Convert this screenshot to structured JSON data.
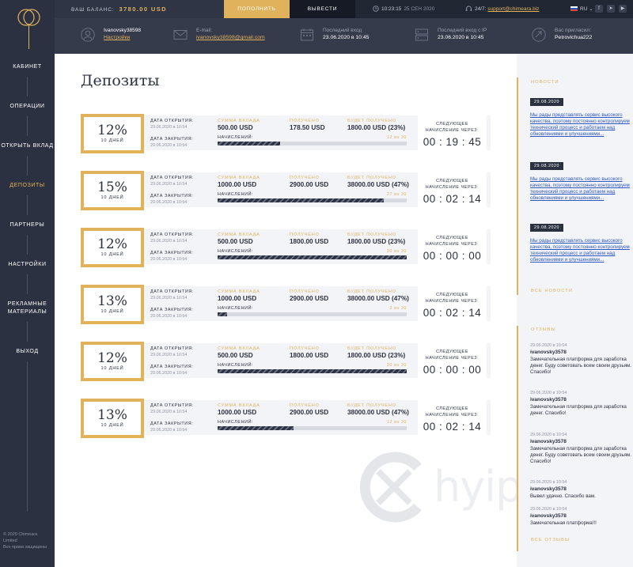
{
  "sidebar": {
    "items": [
      {
        "label": "КАБИНЕТ"
      },
      {
        "label": "ОПЕРАЦИИ"
      },
      {
        "label": "ОТКРЫТЬ ВКЛАД"
      },
      {
        "label": "ДЕПОЗИТЫ"
      },
      {
        "label": "ПАРТНЕРЫ"
      },
      {
        "label": "НАСТРОЙКИ"
      },
      {
        "label_line1": "РЕКЛАМНЫЕ",
        "label_line2": "МАТЕРИАЛЫ"
      },
      {
        "label": "ВЫХОД"
      }
    ],
    "active_index": 3,
    "copyright_line1": "© 2020 Chimeara Limited",
    "copyright_line2": "Все права защищены"
  },
  "topbar": {
    "balance_label": "ВАШ БАЛАНС:",
    "balance_value": "3780.00 USD",
    "deposit_button": "ПОПОЛНИТЬ",
    "withdraw_button": "ВЫВЕСТИ",
    "time": "10:23:15",
    "date": "25 СЕН 2020",
    "support_label": "24/7:",
    "support_email": "support@chimeara.biz",
    "language": "RU",
    "social_icons": [
      "facebook-icon",
      "telegram-icon",
      "youtube-icon"
    ]
  },
  "infobar": {
    "user_name": "Ivanovsky38598",
    "settings_link": "Настройки",
    "email_label": "E-mail:",
    "email_value": "ivanovsky38598@gmail.com",
    "last_login_label": "Последний вход",
    "last_login_value": "23.06.2020 в 10:45",
    "last_ip_label": "Последний вход с IP",
    "last_ip_value": "23.06.2020 в 10:45",
    "referrer_label": "Вас пригласил:",
    "referrer_value": "Petrovichua222"
  },
  "main": {
    "title": "Депозиты",
    "labels": {
      "opened": "ДАТА ОТКРЫТИЯ:",
      "closed": "ДАТА ЗАКРЫТИЯ:",
      "accruals": "НАЧИСЛЕНИЙ:",
      "amount": "СУММА ВКЛАДА",
      "received": "ПОЛУЧЕНО",
      "will_receive": "БУДЕТ ПОЛУЧЕНО",
      "next_accrual": "СЛЕДУЮЩЕЕ",
      "next_accrual_2": "НАЧИСЛЕНИЕ ЧЕРЕЗ:"
    },
    "deposits": [
      {
        "percent": "12%",
        "days": "10 ДНЕЙ",
        "opened": "29.06.2020 в 10:54",
        "closed": "29.06.2020 в 10:54",
        "amount": "500.00 USD",
        "received": "178.50 USD",
        "will_receive": "1800.00 USD (23%)",
        "accruals": "12 из 30",
        "progress": 0.33,
        "timer": "00 : 19 : 45"
      },
      {
        "percent": "15%",
        "days": "10 ДНЕЙ",
        "opened": "29.06.2020 в 10:54",
        "closed": "29.06.2020 в 10:54",
        "amount": "1000.00 USD",
        "received": "2900.00 USD",
        "will_receive": "38000.00 USD (47%)",
        "accruals": "27 из 30",
        "progress": 0.88,
        "timer": "00 : 02 : 14"
      },
      {
        "percent": "12%",
        "days": "10 ДНЕЙ",
        "opened": "29.06.2020 в 10:54",
        "closed": "29.06.2020 в 10:54",
        "amount": "500.00 USD",
        "received": "1800.00 USD",
        "will_receive": "1800.00 USD (23%)",
        "accruals": "30 из 30",
        "progress": 1.0,
        "timer": "00 : 00 : 00"
      },
      {
        "percent": "13%",
        "days": "10 ДНЕЙ",
        "opened": "29.06.2020 в 10:54",
        "closed": "29.06.2020 в 10:54",
        "amount": "1000.00 USD",
        "received": "2900.00 USD",
        "will_receive": "38000.00 USD (47%)",
        "accruals": "2 из 30",
        "progress": 0.05,
        "timer": "00 : 02 : 14"
      },
      {
        "percent": "12%",
        "days": "10 ДНЕЙ",
        "opened": "29.06.2020 в 10:54",
        "closed": "29.06.2020 в 10:54",
        "amount": "500.00 USD",
        "received": "1800.00 USD",
        "will_receive": "1800.00 USD (23%)",
        "accruals": "30 из 30",
        "progress": 1.0,
        "timer": "00 : 00 : 00"
      },
      {
        "percent": "13%",
        "days": "10 ДНЕЙ",
        "opened": "29.06.2020 в 10:54",
        "closed": "29.06.2020 в 10:54",
        "amount": "1000.00 USD",
        "received": "2900.00 USD",
        "will_receive": "38000.00 USD (47%)",
        "accruals": "12 из 30",
        "progress": 0.4,
        "timer": "00 : 02 : 14"
      }
    ]
  },
  "news": {
    "title": "НОВОСТИ",
    "items": [
      {
        "date": "29.08.2020",
        "text": "Мы рады представлять сервис высокого качества, поэтому постоянно контролируем технический процесс и работаем над обновлениями и улучшениями..."
      },
      {
        "date": "29.08.2020",
        "text": "Мы рады представлять сервис высокого качества, поэтому постоянно контролируем технический процесс и работаем над обновлениями и улучшениями..."
      },
      {
        "date": "29.08.2020",
        "text": "Мы рады представлять сервис высокого качества, поэтому постоянно контролируем технический процесс и работаем над обновлениями и улучшениями..."
      }
    ],
    "all_link": "ВСЕ НОВОСТИ"
  },
  "reviews": {
    "title": "ОТЗЫВЫ",
    "items": [
      {
        "date": "29.06.2020 в 10:54",
        "name": "ivanovsky3578",
        "text": "Замечательная платформа для заработка денег. Буду советовать всем своим друзьям. Спасибо!"
      },
      {
        "date": "29.06.2020 в 10:54",
        "name": "ivanovsky3578",
        "text": "Замечательная платформа для заработка денег. Спасибо!"
      },
      {
        "date": "29.06.2020 в 10:54",
        "name": "ivanovsky3578",
        "text": "Замечательная платформа для заработка денег. Буду советовать всем своим друзьям. Спасибо!"
      },
      {
        "date": "29.06.2020 в 10:54",
        "name": "ivanovsky3578",
        "text": "Вывел удачно. Спасибо вам."
      },
      {
        "date": "29.06.2020 в 10:54",
        "name": "ivanovsky3578",
        "text": "Замечательная платформа!!!"
      }
    ],
    "all_link": "ВСЕ ОТЗЫВЫ"
  },
  "watermark": "hyip.com",
  "colors": {
    "accent": "#e0b25c",
    "sidebar": "#2b3140",
    "link": "#2f57c4"
  }
}
